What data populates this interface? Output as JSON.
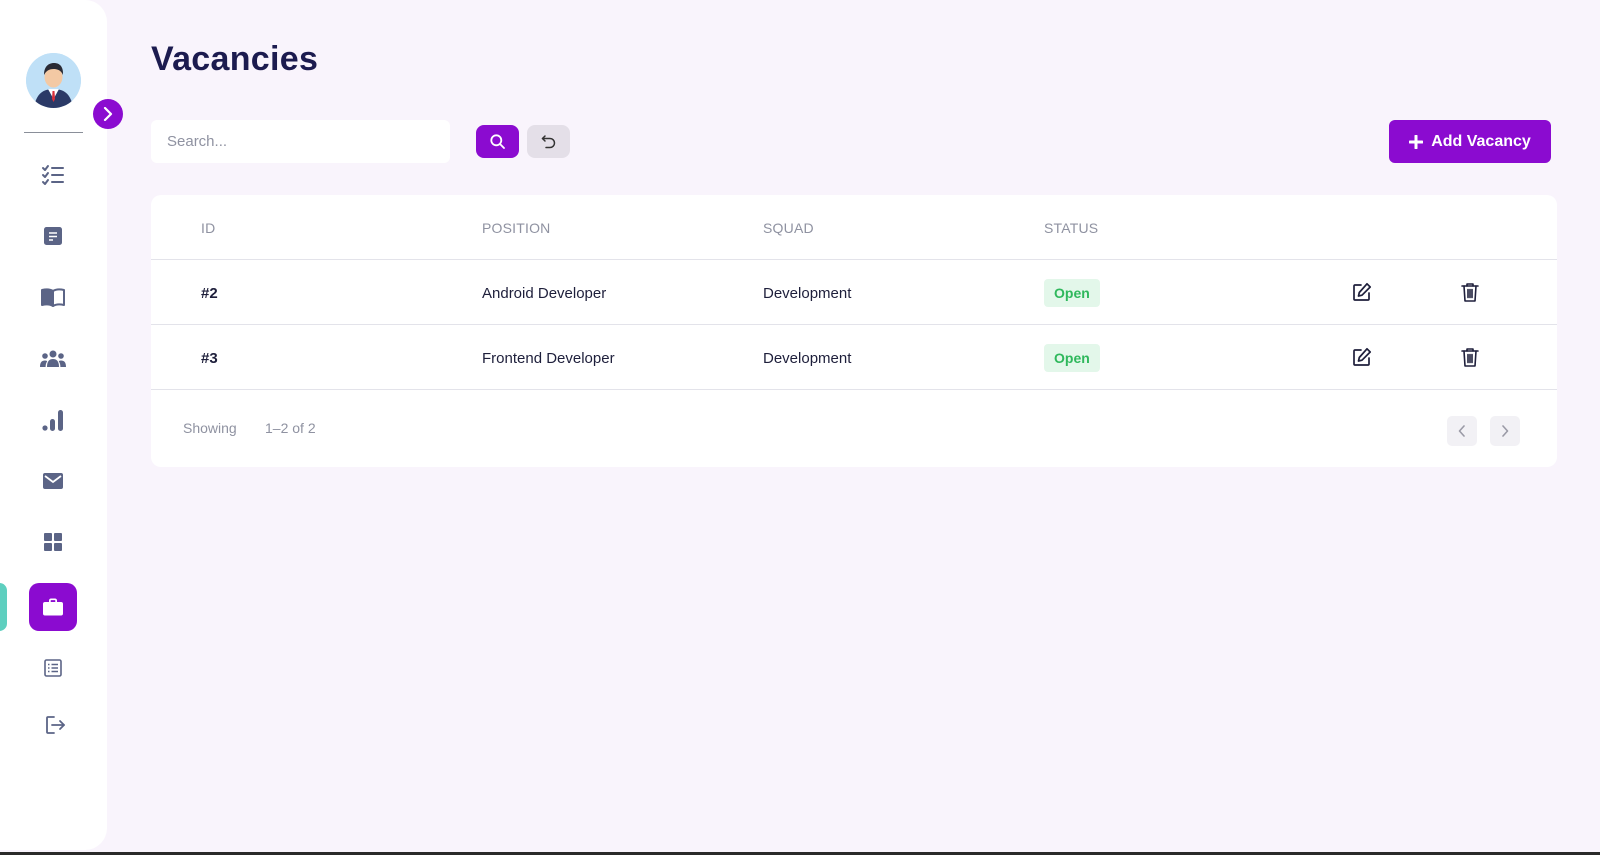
{
  "page": {
    "title": "Vacancies"
  },
  "toolbar": {
    "search_placeholder": "Search...",
    "add_label": "Add Vacancy"
  },
  "sidebar": {
    "items": [
      {
        "icon": "checklist-icon",
        "active": false
      },
      {
        "icon": "notes-icon",
        "active": false
      },
      {
        "icon": "book-icon",
        "active": false
      },
      {
        "icon": "team-icon",
        "active": false
      },
      {
        "icon": "bar-chart-icon",
        "active": false
      },
      {
        "icon": "mail-icon",
        "active": false
      },
      {
        "icon": "grid-icon",
        "active": false
      },
      {
        "icon": "briefcase-icon",
        "active": true
      },
      {
        "icon": "list-icon",
        "active": false
      },
      {
        "icon": "logout-icon",
        "active": false
      }
    ]
  },
  "table": {
    "headers": {
      "id": "ID",
      "position": "POSITION",
      "squad": "SQUAD",
      "status": "STATUS"
    },
    "rows": [
      {
        "id": "#2",
        "position": "Android Developer",
        "squad": "Development",
        "status": "Open"
      },
      {
        "id": "#3",
        "position": "Frontend Developer",
        "squad": "Development",
        "status": "Open"
      }
    ]
  },
  "pagination": {
    "showing_label": "Showing",
    "range": "1–2 of 2"
  },
  "colors": {
    "accent": "#8b0bd0",
    "background": "#f9f4fc",
    "status_open_text": "#2fb85c",
    "status_open_bg": "#e3f7ea",
    "title": "#1c1b4f"
  }
}
